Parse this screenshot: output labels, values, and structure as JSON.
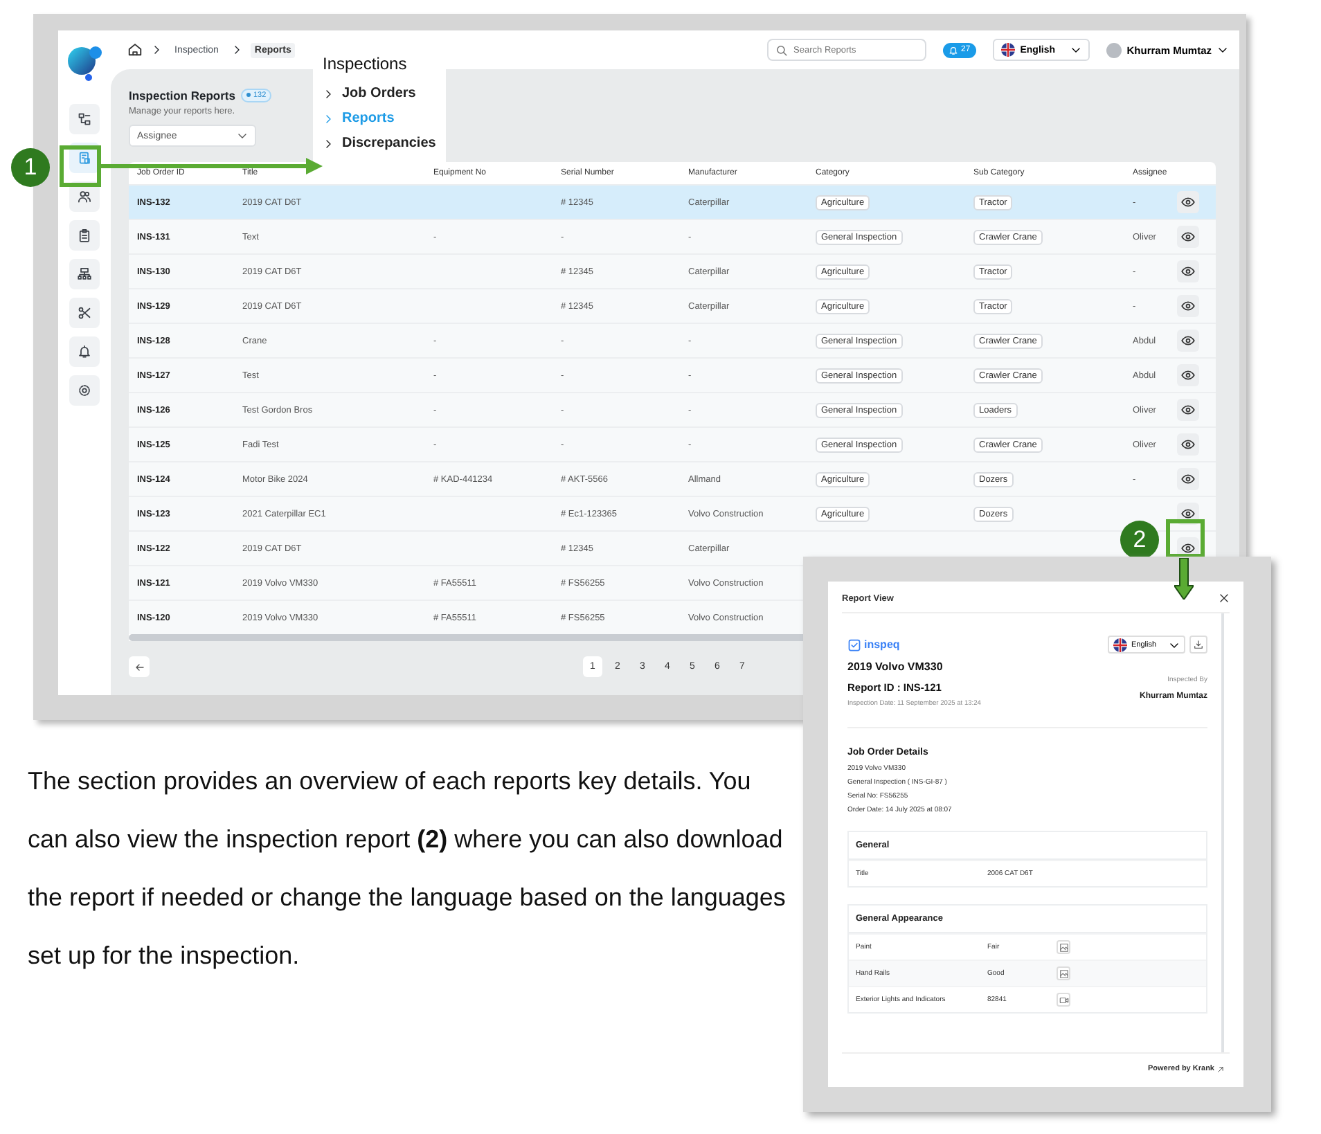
{
  "header": {
    "breadcrumb": [
      "Inspection",
      "Reports"
    ],
    "search": {
      "placeholder": "Search Reports"
    },
    "notifications": "27",
    "language": "English",
    "user": "Khurram Mumtaz"
  },
  "sidebar": {
    "items": [
      {
        "kind": "workflow",
        "selected": false
      },
      {
        "kind": "report",
        "selected": true
      },
      {
        "kind": "users",
        "selected": false
      },
      {
        "kind": "clipboard",
        "selected": false
      },
      {
        "kind": "hierarchy",
        "selected": false
      },
      {
        "kind": "tools",
        "selected": false
      },
      {
        "kind": "bell",
        "selected": false
      },
      {
        "kind": "settings",
        "selected": false
      }
    ]
  },
  "page": {
    "title": "Inspection Reports",
    "count": "132",
    "subtitle": "Manage your reports here.",
    "filter": "Assignee"
  },
  "menu": {
    "title": "Inspections",
    "items": [
      {
        "label": "Job Orders",
        "selected": false
      },
      {
        "label": "Reports",
        "selected": true
      },
      {
        "label": "Discrepancies",
        "selected": false
      }
    ]
  },
  "table": {
    "columns": [
      "Job Order ID",
      "Title",
      "Equipment No",
      "Serial Number",
      "Manufacturer",
      "Category",
      "Sub Category",
      "Assignee"
    ],
    "rows": [
      {
        "id": "INS-132",
        "title": "2019 CAT D6T",
        "serial": "# 12345",
        "manufacturer": "Caterpillar",
        "category": "Agriculture",
        "subcategory": "Tractor",
        "assignee": "-",
        "selected": true
      },
      {
        "id": "INS-131",
        "title": "Text",
        "equipment": "-",
        "serial": "-",
        "manufacturer": "-",
        "category": "General Inspection",
        "subcategory": "Crawler Crane",
        "assignee": "Oliver",
        "selected": false
      },
      {
        "id": "INS-130",
        "title": "2019 CAT D6T",
        "serial": "# 12345",
        "manufacturer": "Caterpillar",
        "category": "Agriculture",
        "subcategory": "Tractor",
        "assignee": "-",
        "selected": false
      },
      {
        "id": "INS-129",
        "title": "2019 CAT D6T",
        "serial": "# 12345",
        "manufacturer": "Caterpillar",
        "category": "Agriculture",
        "subcategory": "Tractor",
        "assignee": "-",
        "selected": false
      },
      {
        "id": "INS-128",
        "title": "Crane",
        "equipment": "-",
        "serial": "-",
        "manufacturer": "-",
        "category": "General Inspection",
        "subcategory": "Crawler Crane",
        "assignee": "Abdul",
        "selected": false
      },
      {
        "id": "INS-127",
        "title": "Test",
        "equipment": "-",
        "serial": "-",
        "manufacturer": "-",
        "category": "General Inspection",
        "subcategory": "Crawler Crane",
        "assignee": "Abdul",
        "selected": false
      },
      {
        "id": "INS-126",
        "title": "Test Gordon Bros",
        "equipment": "-",
        "serial": "-",
        "manufacturer": "-",
        "category": "General Inspection",
        "subcategory": "Loaders",
        "assignee": "Oliver",
        "selected": false
      },
      {
        "id": "INS-125",
        "title": "Fadi Test",
        "equipment": "-",
        "serial": "-",
        "manufacturer": "-",
        "category": "General Inspection",
        "subcategory": "Crawler Crane",
        "assignee": "Oliver",
        "selected": false
      },
      {
        "id": "INS-124",
        "title": "Motor Bike 2024",
        "equipment": "# KAD-441234",
        "serial": "# AKT-5566",
        "manufacturer": "Allmand",
        "category": "Agriculture",
        "subcategory": "Dozers",
        "assignee": "-",
        "selected": false
      },
      {
        "id": "INS-123",
        "title": "2021 Caterpillar EC1",
        "serial": "# Ec1-123365",
        "manufacturer": "Volvo Construction",
        "category": "Agriculture",
        "subcategory": "Dozers",
        "selected": false
      },
      {
        "id": "INS-122",
        "title": "2019 CAT D6T",
        "serial": "# 12345",
        "manufacturer": "Caterpillar",
        "selected": false
      },
      {
        "id": "INS-121",
        "title": "2019 Volvo VM330",
        "equipment": "# FA55511",
        "serial": "# FS56255",
        "manufacturer": "Volvo Construction",
        "selected": false
      },
      {
        "id": "INS-120",
        "title": "2019 Volvo VM330",
        "equipment": "# FA55511",
        "serial": "# FS56255",
        "manufacturer": "Volvo Construction",
        "selected": false
      }
    ]
  },
  "pagination": {
    "pages": [
      {
        "label": "1",
        "selected": true
      },
      {
        "label": "2",
        "selected": false
      },
      {
        "label": "3",
        "selected": false
      },
      {
        "label": "4",
        "selected": false
      },
      {
        "label": "5",
        "selected": false
      },
      {
        "label": "6",
        "selected": false
      },
      {
        "label": "7",
        "selected": false
      }
    ]
  },
  "callouts": [
    "1",
    "2"
  ],
  "report_view": {
    "title": "Report View",
    "logo": "inspeq",
    "language": "English",
    "vehicle": "2019 Volvo VM330",
    "report_id": "Report ID :  INS-121",
    "inspection_date": "Inspection Date: 11 September 2025 at 13:24",
    "inspected_by_label": "Inspected By",
    "inspector": "Khurram Mumtaz",
    "job_order": {
      "heading": "Job Order Details",
      "lines": [
        "2019 Volvo VM330",
        "General Inspection ( INS-GI-87 )",
        "Serial No: FS56255",
        "Order Date: 14 July 2025 at 08:07"
      ]
    },
    "sections": [
      {
        "heading": "General",
        "rows": [
          {
            "label": "Title",
            "value": "2006 CAT D6T"
          }
        ]
      },
      {
        "heading": "General Appearance",
        "rows": [
          {
            "label": "Paint",
            "value": "Fair",
            "kind": "photo"
          },
          {
            "label": "Hand Rails",
            "value": "Good",
            "kind": "photo"
          },
          {
            "label": "Exterior Lights and Indicators",
            "value": "82841",
            "kind": "video"
          }
        ]
      }
    ],
    "footer": "Powered by Krank"
  },
  "description": "The section provides an overview of each reports key details. You can also view the inspection report **(2)** where you can also download the report if needed or change the language based on the languages set up for the inspection."
}
